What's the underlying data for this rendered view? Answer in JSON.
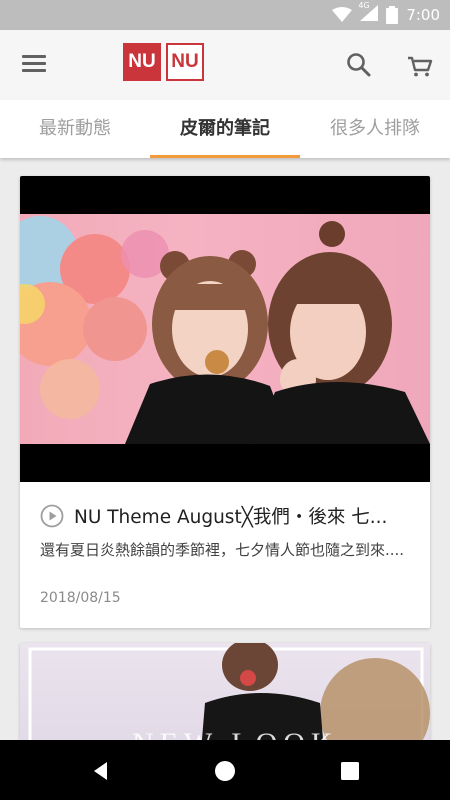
{
  "status_bar": {
    "time": "7:00",
    "network": "4G"
  },
  "toolbar": {
    "logo_left": "NU",
    "logo_right": "NU",
    "icons": [
      "menu-icon",
      "search-icon",
      "cart-icon"
    ]
  },
  "tabs": [
    {
      "label": "最新動態",
      "active": false
    },
    {
      "label": "皮爾的筆記",
      "active": true
    },
    {
      "label": "很多人排隊",
      "active": false
    }
  ],
  "colors": {
    "accent": "#f39a3a",
    "brand": "#c9353b",
    "status_bar": "#bdbdbd"
  },
  "posts": [
    {
      "title": "NU Theme August╳我們・後來 七...",
      "description": "還有夏日炎熱餘韻的季節裡，七夕情人節也隨之到來....",
      "date": "2018/08/15",
      "media_icon": "play-icon"
    },
    {
      "overlay_text": "NEW LOOK"
    }
  ],
  "nav_bar": {
    "icons": [
      "back-icon",
      "home-icon",
      "recents-icon"
    ]
  }
}
